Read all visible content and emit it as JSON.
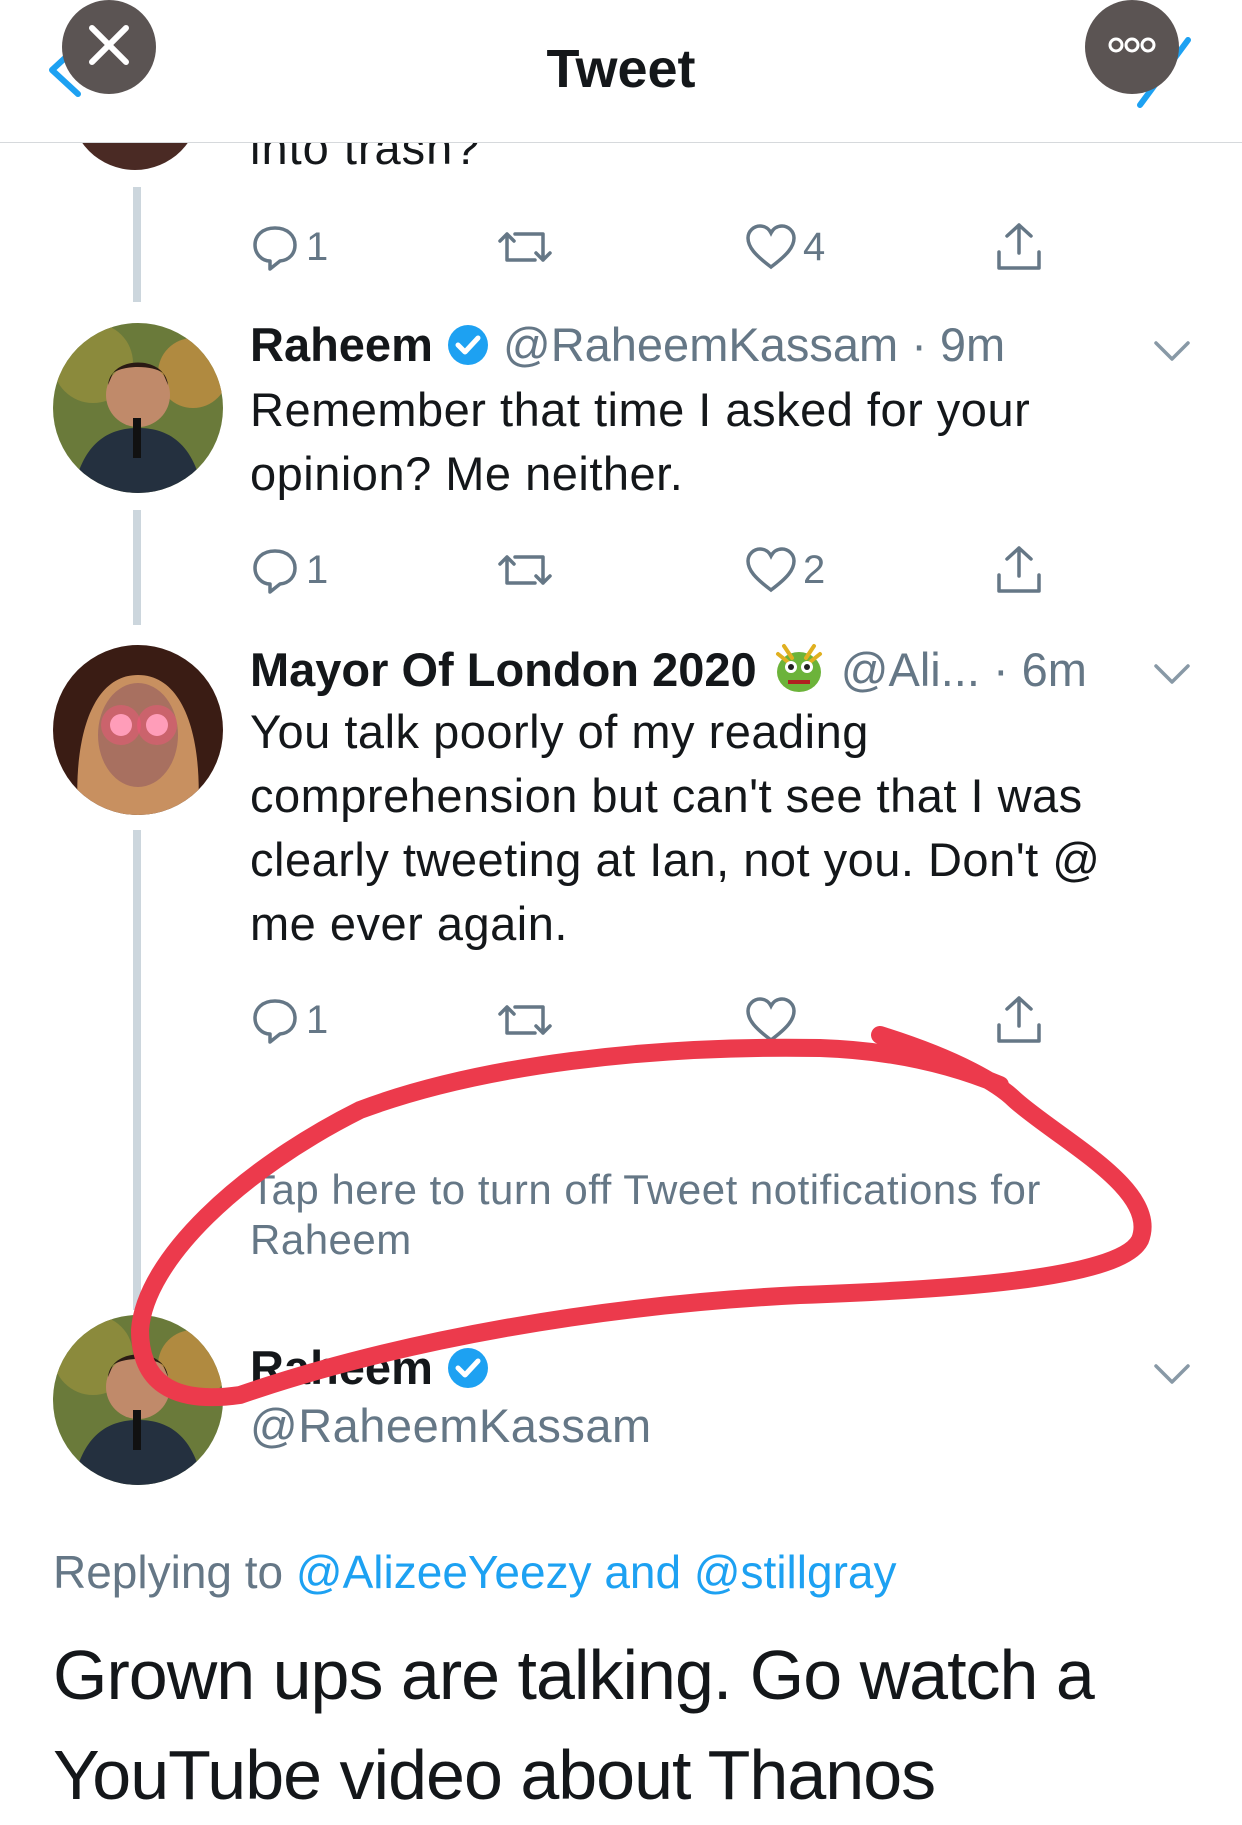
{
  "header": {
    "title": "Tweet",
    "close_icon": "close-icon",
    "more_icon": "more-icon"
  },
  "prev_tweet": {
    "partial_text": "into trash?",
    "reply_count": "1",
    "like_count": "4"
  },
  "tweets": [
    {
      "name": "Raheem",
      "verified": true,
      "handle": "@RaheemKassam",
      "time": "· 9m",
      "text": "Remember that time I asked for your opinion? Me neither.",
      "reply_count": "1",
      "like_count": "2"
    },
    {
      "name": "Mayor Of London 2020",
      "emoji": "dragon-face",
      "handle": "@Ali...",
      "time": "· 6m",
      "text": "You talk poorly of my reading comprehension but can't see that I was clearly tweeting at Ian, not you. Don't @ me ever again.",
      "reply_count": "1",
      "like_count": ""
    }
  ],
  "notification": {
    "text": "Tap here to turn off Tweet notifications for Raheem"
  },
  "main_tweet": {
    "name": "Raheem",
    "handle": "@RaheemKassam",
    "replying_prefix": "Replying to",
    "reply_user1": "@AlizeeYeezy",
    "reply_and": "and",
    "reply_user2": "@stillgray",
    "text": "Grown ups are talking. Go watch a YouTube video about Thanos"
  },
  "annotation": {
    "color": "#ec3a4c"
  }
}
